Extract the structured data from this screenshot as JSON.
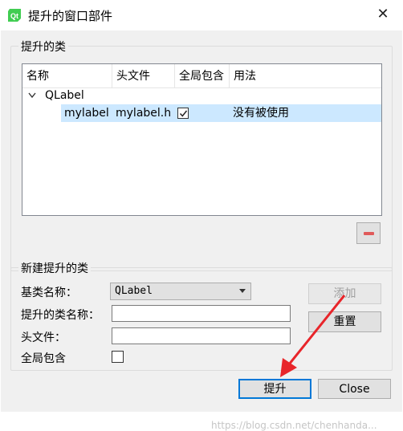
{
  "window": {
    "title": "提升的窗口部件",
    "close_glyph": "✕"
  },
  "promoted_group": {
    "title": "提升的类",
    "columns": [
      "名称",
      "头文件",
      "全局包含",
      "用法"
    ],
    "base_class": "QLabel",
    "rows": [
      {
        "name": "mylabel",
        "header": "mylabel.h",
        "global_include": true,
        "usage": "没有被使用"
      }
    ],
    "remove_button": "remove"
  },
  "new_group": {
    "title": "新建提升的类",
    "base_class_label": "基类名称：",
    "base_class_value": "QLabel",
    "promoted_name_label": "提升的类名称：",
    "promoted_name_value": "",
    "header_label": "头文件：",
    "header_value": "",
    "global_include_label": "全局包含",
    "global_include_checked": false,
    "add_button": "添加",
    "reset_button": "重置"
  },
  "buttons": {
    "promote": "提升",
    "close": "Close"
  },
  "watermark": "https://blog.csdn.net/chenhanda...",
  "colors": {
    "selection": "#cce8ff",
    "arrow": "#e8252a",
    "qt_icon": "#41cd52"
  }
}
